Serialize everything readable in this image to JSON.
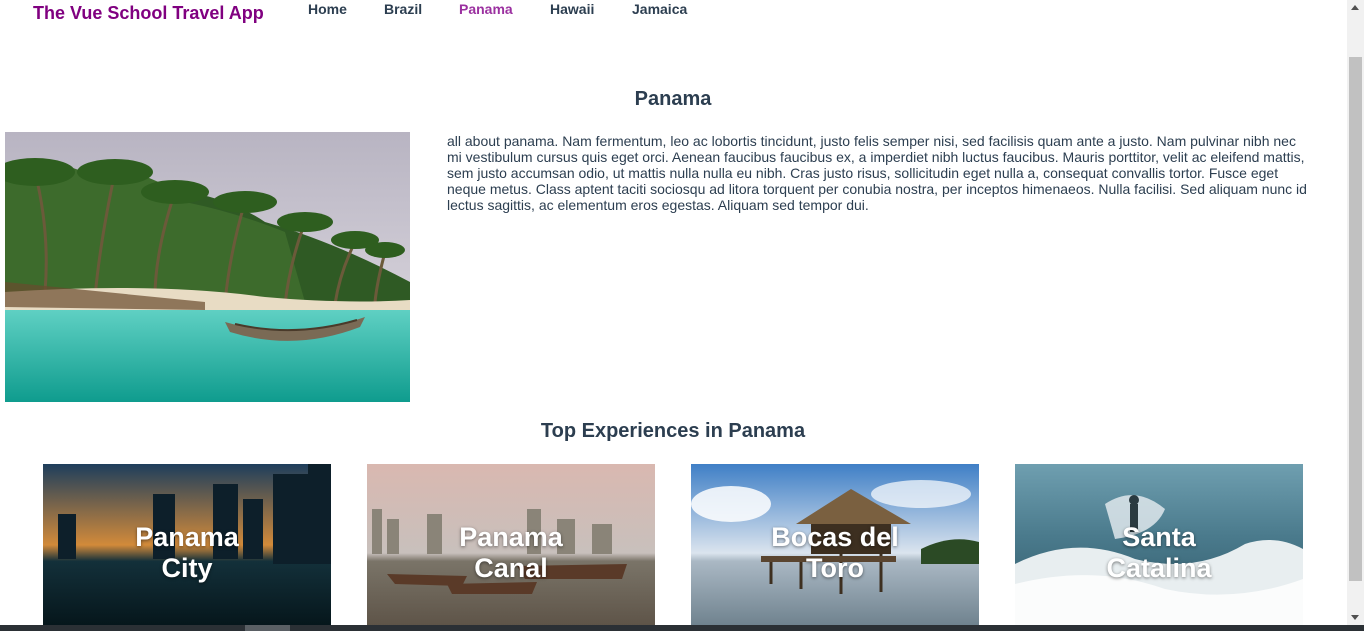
{
  "header": {
    "brand": "The Vue School Travel App",
    "nav": [
      {
        "label": "Home"
      },
      {
        "label": "Brazil"
      },
      {
        "label": "Panama"
      },
      {
        "label": "Hawaii"
      },
      {
        "label": "Jamaica"
      }
    ],
    "active": "Panama"
  },
  "destination": {
    "title": "Panama",
    "description": "all about panama. Nam fermentum, leo ac lobortis tincidunt, justo felis semper nisi, sed facilisis quam ante a justo. Nam pulvinar nibh nec mi vestibulum cursus quis eget orci. Aenean faucibus faucibus ex, a imperdiet nibh luctus faucibus. Mauris porttitor, velit ac eleifend mattis, sem justo accumsan odio, ut mattis nulla nulla eu nibh. Cras justo risus, sollicitudin eget nulla a, consequat convallis tortor. Fusce eget neque metus. Class aptent taciti sociosqu ad litora torquent per conubia nostra, per inceptos himenaeos. Nulla facilisi. Sed aliquam nunc id lectus sagittis, ac elementum eros egestas. Aliquam sed tempor dui."
  },
  "experiences": {
    "title": "Top Experiences in Panama",
    "items": [
      {
        "name": "Panama City"
      },
      {
        "name": "Panama Canal"
      },
      {
        "name": "Bocas del Toro"
      },
      {
        "name": "Santa Catalina"
      }
    ]
  },
  "colors": {
    "brand": "#800080",
    "active_link": "#9b30a0",
    "text": "#2c3e50"
  }
}
